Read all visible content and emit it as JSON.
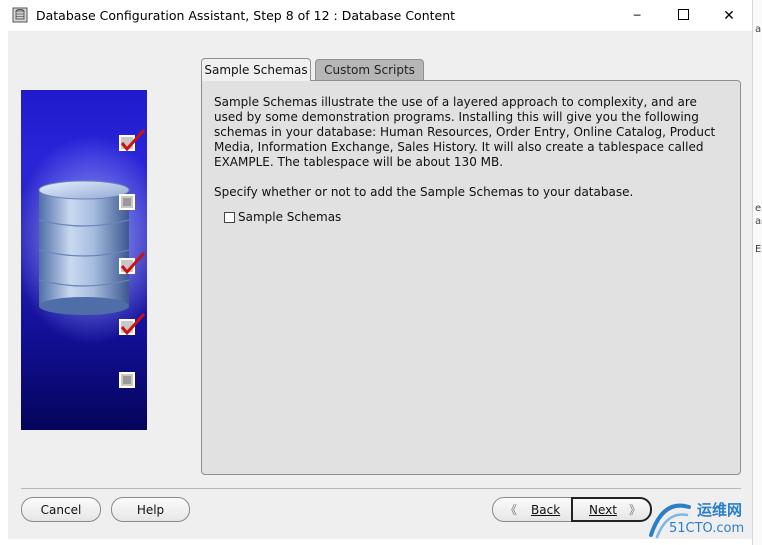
{
  "window": {
    "title": "Database Configuration Assistant, Step 8 of 12 : Database Content",
    "minimize_symbol": "─",
    "close_symbol": "✕"
  },
  "background_window": {
    "fragments": [
      "a",
      "e",
      "as",
      "E"
    ]
  },
  "steps_indicator": [
    "checked",
    "unchecked",
    "checked",
    "checked",
    "unchecked"
  ],
  "tabs": [
    {
      "label": "Sample Schemas",
      "active": true
    },
    {
      "label": "Custom Scripts",
      "active": false
    }
  ],
  "content": {
    "description": "Sample Schemas illustrate the use of a layered approach to complexity, and are used by some demonstration programs. Installing this will give you the following schemas in your database: Human Resources, Order Entry, Online Catalog, Product Media, Information Exchange, Sales History. It will also create a tablespace called EXAMPLE. The tablespace will be about 130 MB.",
    "prompt": "Specify whether or not to add the Sample Schemas to your database.",
    "checkbox": {
      "label": "Sample Schemas",
      "checked": false
    }
  },
  "buttons": {
    "cancel": "Cancel",
    "help": "Help",
    "back": "Back",
    "next": "Next",
    "back_arrow": "《",
    "next_arrow": "》"
  },
  "watermark": {
    "line1": "运维网",
    "line2": "51CTO.com"
  },
  "colors": {
    "panel_bg": "#e1e1e1",
    "dialog_bg": "#efefef",
    "check_red": "#cc1111",
    "graphic_blue": "#2620b6",
    "watermark_blue": "#2b7fc9"
  }
}
